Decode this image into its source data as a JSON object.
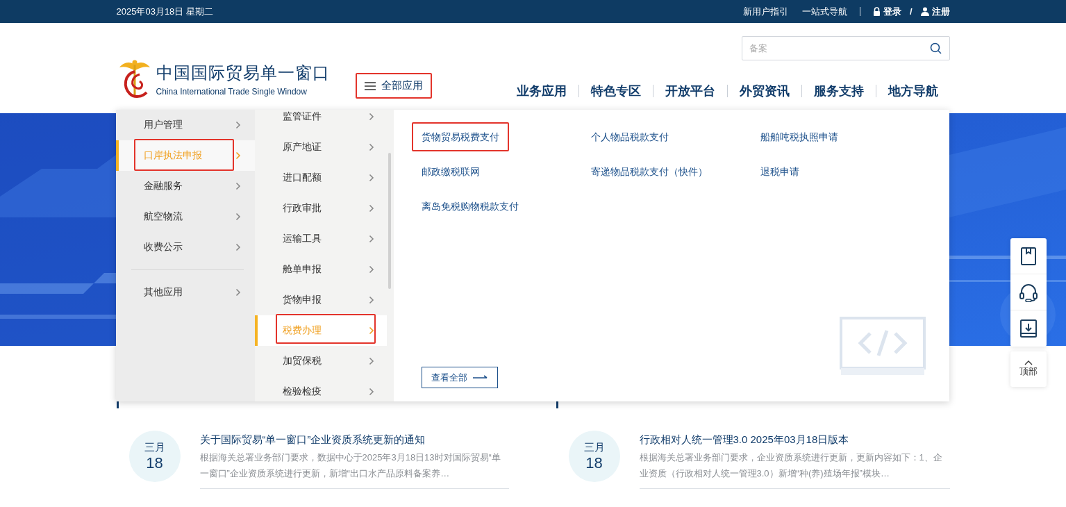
{
  "top_bar": {
    "date": "2025年03月18日 星期二",
    "links": [
      "新用户指引",
      "一站式导航"
    ],
    "login": "登录",
    "separator": "/",
    "register": "注册"
  },
  "header": {
    "logo_title": "中国国际贸易单一窗口",
    "logo_subtitle": "China International Trade Single Window",
    "all_apps": {
      "label": "全部应用",
      "highlighted": true
    },
    "search": {
      "placeholder": "备案"
    },
    "nav": [
      "业务应用",
      "特色专区",
      "开放平台",
      "外贸资讯",
      "服务支持",
      "地方导航"
    ]
  },
  "menu": {
    "categories": [
      {
        "label": "用户管理",
        "selected": false,
        "highlighted": false
      },
      {
        "label": "口岸执法申报",
        "selected": true,
        "highlighted": true
      },
      {
        "label": "金融服务",
        "selected": false,
        "highlighted": false
      },
      {
        "label": "航空物流",
        "selected": false,
        "highlighted": false
      },
      {
        "label": "收费公示",
        "selected": false,
        "highlighted": false
      }
    ],
    "other_categories": [
      {
        "label": "其他应用",
        "selected": false,
        "highlighted": false
      }
    ],
    "subcategories": [
      {
        "label": "监管证件",
        "selected": false,
        "highlighted": false
      },
      {
        "label": "原产地证",
        "selected": false,
        "highlighted": false
      },
      {
        "label": "进口配额",
        "selected": false,
        "highlighted": false
      },
      {
        "label": "行政审批",
        "selected": false,
        "highlighted": false
      },
      {
        "label": "运输工具",
        "selected": false,
        "highlighted": false
      },
      {
        "label": "舱单申报",
        "selected": false,
        "highlighted": false
      },
      {
        "label": "货物申报",
        "selected": false,
        "highlighted": false
      },
      {
        "label": "税费办理",
        "selected": true,
        "highlighted": true
      },
      {
        "label": "加贸保税",
        "selected": false,
        "highlighted": false
      },
      {
        "label": "检验检疫",
        "selected": false,
        "highlighted": false
      }
    ],
    "links": [
      {
        "label": "货物贸易税费支付",
        "highlighted": true
      },
      {
        "label": "个人物品税款支付",
        "highlighted": false
      },
      {
        "label": "船舶吨税执照申请",
        "highlighted": false
      },
      {
        "label": "邮政缴税联网",
        "highlighted": false
      },
      {
        "label": "寄递物品税款支付（快件）",
        "highlighted": false
      },
      {
        "label": "退税申请",
        "highlighted": false
      },
      {
        "label": "离岛免税购物税款支付",
        "highlighted": false
      }
    ],
    "view_all": "查看全部"
  },
  "sections": [
    {
      "news": [
        {
          "month": "三月",
          "day": "18",
          "title": "关于国际贸易“单一窗口”企业资质系统更新的通知",
          "summary": "根据海关总署业务部门要求，数据中心于2025年3月18日13时对国际贸易“单一窗口”企业资质系统进行更新，新增“出口水产品原料备案养…"
        }
      ]
    },
    {
      "news": [
        {
          "month": "三月",
          "day": "18",
          "title": "行政相对人统一管理3.0 2025年03月18日版本",
          "summary": "根据海关总署业务部门要求，企业资质系统进行更新，更新内容如下：1、企业资质（行政相对人统一管理3.0）新增“种(养)殖场年报”模块…"
        }
      ]
    }
  ],
  "side_tools": {
    "top": "顶部"
  }
}
